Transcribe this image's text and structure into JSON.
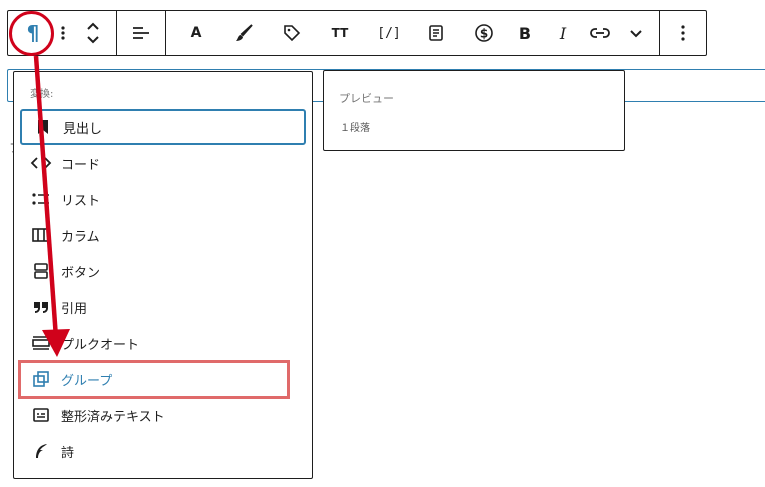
{
  "colors": {
    "accent": "#2f7fb0",
    "annotation_red": "#d0021b",
    "annotation_box": "#e06a6a",
    "border": "#1e1e1e"
  },
  "toolbar": {
    "buttons": [
      {
        "name": "paragraph-icon",
        "glyph": "¶"
      },
      {
        "name": "drag-handle-icon"
      },
      {
        "name": "move-up-down-icon"
      },
      {
        "name": "align-icon"
      },
      {
        "name": "text-color-icon",
        "glyph": "A"
      },
      {
        "name": "brush-icon"
      },
      {
        "name": "tag-icon"
      },
      {
        "name": "font-size-icon",
        "glyph": "TT"
      },
      {
        "name": "shortcode-icon",
        "glyph": "[/]"
      },
      {
        "name": "document-icon"
      },
      {
        "name": "dollar-icon"
      },
      {
        "name": "bold-icon",
        "glyph": "B"
      },
      {
        "name": "italic-icon",
        "glyph": "I"
      },
      {
        "name": "link-icon"
      },
      {
        "name": "chevron-down-icon"
      },
      {
        "name": "more-options-icon"
      }
    ]
  },
  "editor": {
    "stray_char": "フ"
  },
  "dropdown": {
    "header": "変換:",
    "items": [
      {
        "label": "見出し",
        "icon": "bookmark-icon"
      },
      {
        "label": "コード",
        "icon": "code-icon"
      },
      {
        "label": "リスト",
        "icon": "list-icon"
      },
      {
        "label": "カラム",
        "icon": "columns-icon"
      },
      {
        "label": "ボタン",
        "icon": "buttons-icon"
      },
      {
        "label": "引用",
        "icon": "quote-icon"
      },
      {
        "label": "プルクオート",
        "icon": "pullquote-icon"
      },
      {
        "label": "グループ",
        "icon": "group-icon"
      },
      {
        "label": "整形済みテキスト",
        "icon": "preformatted-icon"
      },
      {
        "label": "詩",
        "icon": "verse-icon"
      }
    ]
  },
  "preview": {
    "label": "プレビュー",
    "content": "１段落"
  }
}
